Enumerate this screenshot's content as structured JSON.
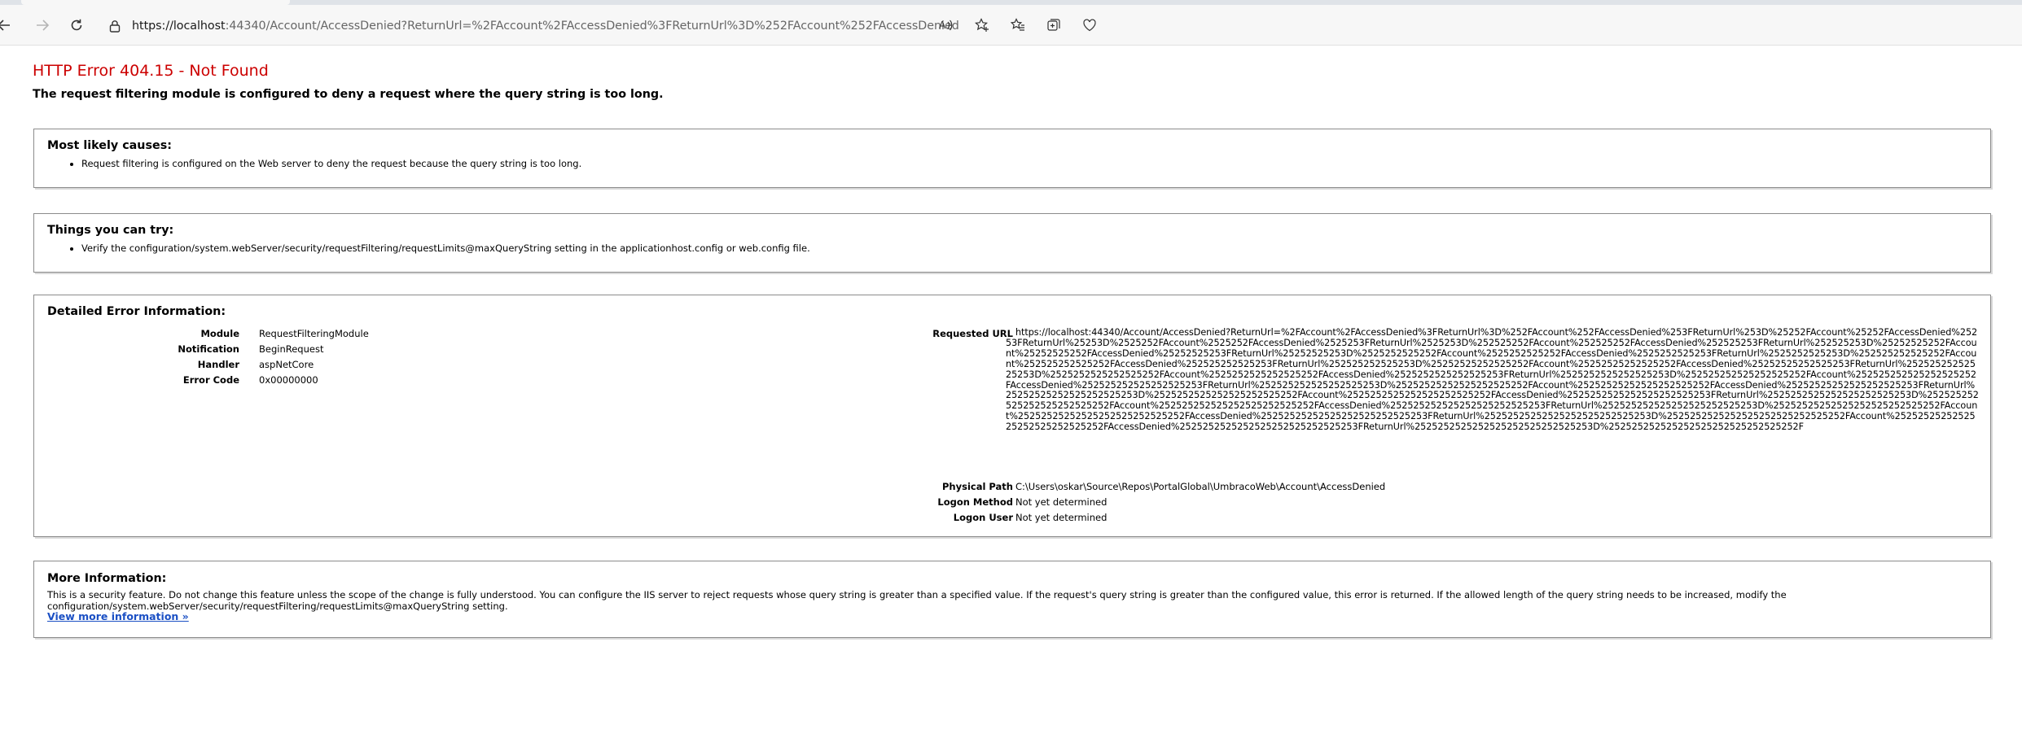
{
  "browser": {
    "url_host": "https://localhost",
    "url_rest": ":44340/Account/AccessDenied?ReturnUrl=%2FAccount%2FAccessDenied%3FReturnUrl%3D%252FAccount%252FAccessDenied%253FReturnUrl%253D%25252FAccount%25252FAccessDenied%25253FReturnUrl%25253D%2525252FAccount%2525252FAccessDenied%2525253FReturnUrl%2525253D%252525252FAccount%25..."
  },
  "error": {
    "title": "HTTP Error 404.15 - Not Found",
    "subtitle": "The request filtering module is configured to deny a request where the query string is too long."
  },
  "causes": {
    "heading": "Most likely causes:",
    "items": [
      "Request filtering is configured on the Web server to deny the request because the query string is too long."
    ]
  },
  "try": {
    "heading": "Things you can try:",
    "items": [
      "Verify the configuration/system.webServer/security/requestFiltering/requestLimits@maxQueryString setting in the applicationhost.config or web.config file."
    ]
  },
  "detail": {
    "heading": "Detailed Error Information:",
    "module_label": "Module",
    "module_value": "RequestFilteringModule",
    "notification_label": "Notification",
    "notification_value": "BeginRequest",
    "handler_label": "Handler",
    "handler_value": "aspNetCore",
    "error_code_label": "Error Code",
    "error_code_value": "0x00000000",
    "requested_url_label": "Requested URL",
    "requested_url_value": "https://localhost:44340/Account/AccessDenied?ReturnUrl=%2FAccount%2FAccessDenied%3FReturnUrl%3D%252FAccount%252FAccessDenied%253FReturnUrl%253D%25252FAccount%25252FAccessDenied%25253FReturnUrl%25253D%2525252FAccount%2525252FAccessDenied%2525253FReturnUrl%2525253D%252525252FAccount%252525252FAccessDenied%252525253FReturnUrl%252525253D%25252525252FAccount%25252525252FAccessDenied%25252525253FReturnUrl%25252525253D%2525252525252FAccount%2525252525252FAccessDenied%2525252525253FReturnUrl%2525252525253D%252525252525252FAccount%252525252525252FAccessDenied%252525252525253FReturnUrl%252525252525253D%25252525252525252FAccount%25252525252525252FAccessDenied%25252525252525253FReturnUrl%25252525252525253D%2525252525252525252FAccount%2525252525252525252FAccessDenied%2525252525252525253FReturnUrl%2525252525252525253D%252525252525252525252FAccount%252525252525252525252FAccessDenied%252525252525252525253FReturnUrl%252525252525252525253D%25252525252525252525252FAccount%25252525252525252525252FAccessDenied%25252525252525252525253FReturnUrl%25252525252525252525253D%2525252525252525252525252FAccount%2525252525252525252525252FAccessDenied%2525252525252525252525253FReturnUrl%2525252525252525252525253D%252525252525252525252525252FAccount%252525252525252525252525252FAccessDenied%252525252525252525252525253FReturnUrl%252525252525252525252525253D%25252525252525252525252525252FAccount%25252525252525252525252525252FAccessDenied%25252525252525252525252525253FReturnUrl%25252525252525252525252525253D%2525252525252525252525252525252FAccount%2525252525252525252525252525252FAccessDenied%2525252525252525252525252525253FReturnUrl%2525252525252525252525252525253D%252525252525252525252525252525252F",
    "physical_path_label": "Physical Path",
    "physical_path_value": "C:\\Users\\oskar\\Source\\Repos\\PortalGlobal\\UmbracoWeb\\Account\\AccessDenied",
    "logon_method_label": "Logon Method",
    "logon_method_value": "Not yet determined",
    "logon_user_label": "Logon User",
    "logon_user_value": "Not yet determined"
  },
  "more": {
    "heading": "More Information:",
    "text": "This is a security feature. Do not change this feature unless the scope of the change is fully understood. You can configure the IIS server to reject requests whose query string is greater than a specified value. If the request's query string is greater than the configured value, this error is returned. If the allowed length of the query string needs to be increased, modify the configuration/system.webServer/security/requestFiltering/requestLimits@maxQueryString setting.",
    "link": "View more information »"
  },
  "icons": {
    "back": "back-arrow-icon",
    "forward": "forward-arrow-icon",
    "reload": "reload-icon",
    "lock": "lock-icon",
    "read_aloud": "read-aloud-icon",
    "favorite": "add-favorite-icon",
    "favorites": "favorites-icon",
    "collections": "collections-icon",
    "heart": "heart-icon"
  }
}
